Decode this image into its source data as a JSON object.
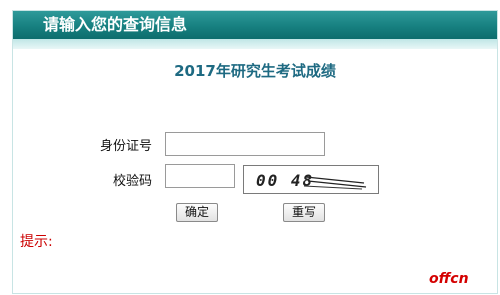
{
  "header": {
    "title": "请输入您的查询信息"
  },
  "main": {
    "title": "2017年研究生考试成绩",
    "id_field": {
      "label": "身份证号",
      "value": ""
    },
    "code_field": {
      "label": "校验码",
      "value": ""
    },
    "captcha": {
      "text": "00 48"
    },
    "buttons": {
      "confirm_label": "确定",
      "reset_label": "重写"
    },
    "hint_label": "提示:"
  },
  "watermark": {
    "text": "offcn",
    "color": "#d40000"
  },
  "colors": {
    "header_bg": "#178080",
    "title_color": "#1e6a82",
    "hint_color": "#cc0000"
  }
}
